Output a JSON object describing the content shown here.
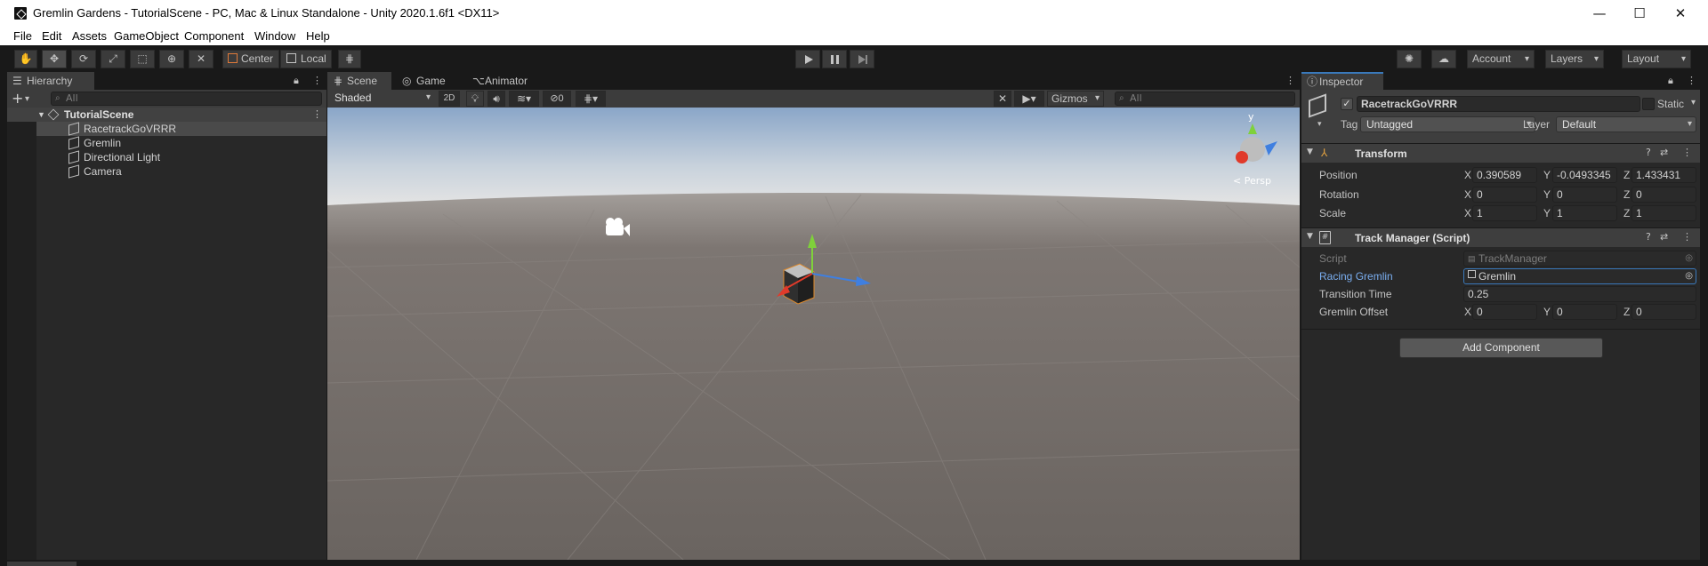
{
  "window": {
    "title": "Gremlin Gardens - TutorialScene - PC, Mac & Linux Standalone - Unity 2020.1.6f1 <DX11>",
    "minimize": "—",
    "maximize": "☐",
    "close": "✕"
  },
  "menu": [
    "File",
    "Edit",
    "Assets",
    "GameObject",
    "Component",
    "Window",
    "Help"
  ],
  "toolbar": {
    "pivot": "Center",
    "space": "Local",
    "account": "Account",
    "layers": "Layers",
    "layout": "Layout",
    "play_icon": "play-icon",
    "pause_icon": "pause-icon",
    "step_icon": "step-icon"
  },
  "hierarchy": {
    "tab": "Hierarchy",
    "search_placeholder": "All",
    "scene": "TutorialScene",
    "items": [
      "RacetrackGoVRRR",
      "Gremlin",
      "Directional Light",
      "Camera"
    ]
  },
  "scene_view": {
    "tabs": [
      "Scene",
      "Game",
      "Animator"
    ],
    "shading": "Shaded",
    "mode_2d": "2D",
    "hidden_count": "0",
    "gizmos": "Gizmos",
    "search_placeholder": "All",
    "persp_label": "< Persp",
    "gizmo_y": "y"
  },
  "inspector": {
    "tab": "Inspector",
    "object_name": "RacetrackGoVRRR",
    "static_label": "Static",
    "tag_label": "Tag",
    "tag_value": "Untagged",
    "layer_label": "Layer",
    "layer_value": "Default",
    "transform": {
      "title": "Transform",
      "position_label": "Position",
      "rotation_label": "Rotation",
      "scale_label": "Scale",
      "position": {
        "x": "0.390589",
        "y": "-0.0493345",
        "z": "1.433431"
      },
      "rotation": {
        "x": "0",
        "y": "0",
        "z": "0"
      },
      "scale": {
        "x": "1",
        "y": "1",
        "z": "1"
      }
    },
    "track_manager": {
      "title": "Track Manager (Script)",
      "script_label": "Script",
      "script_value": "TrackManager",
      "racing_label": "Racing Gremlin",
      "racing_value": "Gremlin",
      "transition_label": "Transition Time",
      "transition_value": "0.25",
      "offset_label": "Gremlin Offset",
      "offset": {
        "x": "0",
        "y": "0",
        "z": "0"
      }
    },
    "add_component": "Add Component",
    "axis_x": "X",
    "axis_y": "Y",
    "axis_z": "Z"
  }
}
